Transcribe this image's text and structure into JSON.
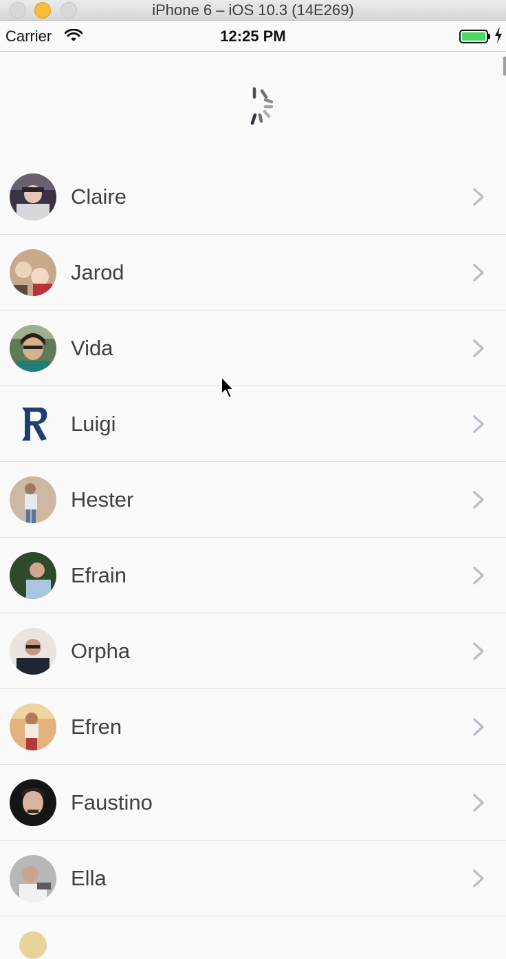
{
  "window": {
    "title": "iPhone 6 – iOS 10.3 (14E269)"
  },
  "status_bar": {
    "carrier": "Carrier",
    "time": "12:25 PM"
  },
  "contacts": [
    {
      "name": "Claire"
    },
    {
      "name": "Jarod"
    },
    {
      "name": "Vida"
    },
    {
      "name": "Luigi"
    },
    {
      "name": "Hester"
    },
    {
      "name": "Efrain"
    },
    {
      "name": "Orpha"
    },
    {
      "name": "Efren"
    },
    {
      "name": "Faustino"
    },
    {
      "name": "Ella"
    }
  ],
  "colors": {
    "battery": "#4cd964",
    "chevron": "#b9bec8",
    "name_text": "#3f3f3f"
  }
}
